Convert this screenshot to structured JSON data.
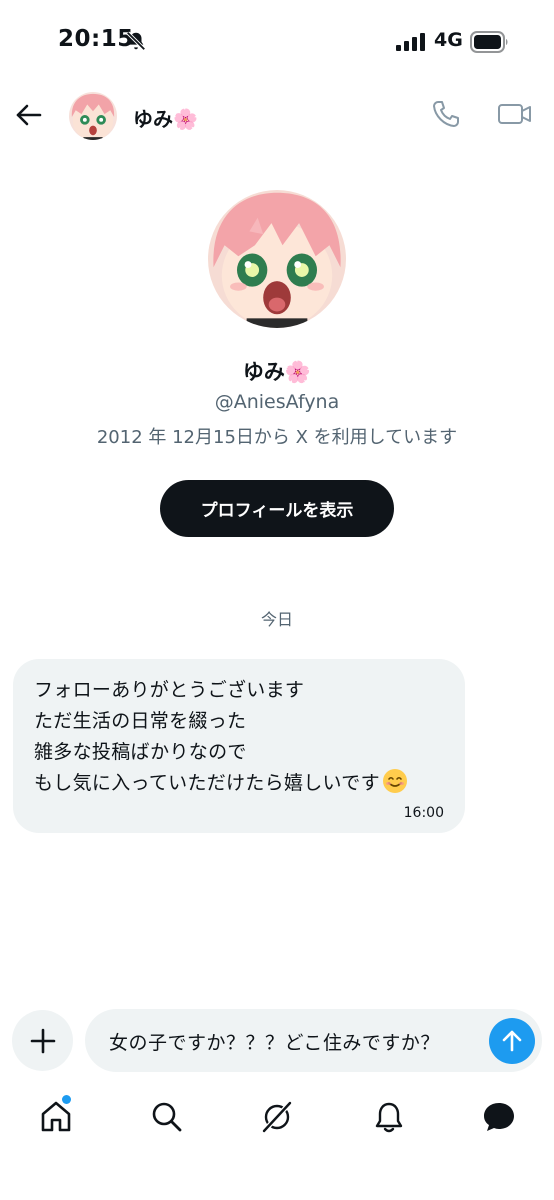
{
  "status_bar": {
    "time": "20:15",
    "network": "4G",
    "icons": [
      "bell-off-icon",
      "signal-icon",
      "battery-icon"
    ]
  },
  "header": {
    "name": "ゆみ🌸",
    "icons": [
      "back-arrow-icon",
      "phone-icon",
      "video-camera-icon"
    ]
  },
  "profile": {
    "name": "ゆみ🌸",
    "handle": "@AniesAfyna",
    "joined": "2012 年 12月15日から X を利用しています",
    "view_profile_label": "プロフィールを表示"
  },
  "conversation": {
    "date_label": "今日",
    "messages": [
      {
        "lines": [
          "フォローありがとうございます",
          "ただ生活の日常を綴った",
          "雑多な投稿ばかりなので",
          "もし気に入っていただけたら嬉しいです"
        ],
        "emoji": "smiling-face-icon",
        "time": "16:00"
      }
    ]
  },
  "composer": {
    "text": "女の子ですか？？？どこ住みですか？",
    "icons": [
      "plus-icon",
      "send-arrow-icon"
    ]
  },
  "bottom_nav": {
    "items": [
      "home-icon",
      "search-icon",
      "grok-icon",
      "notifications-icon",
      "messages-icon"
    ],
    "home_has_badge": true
  },
  "colors": {
    "accent": "#1d9bf0",
    "text": "#0f1419",
    "secondary_text": "#536471",
    "bubble": "#eff3f4",
    "button_dark": "#0f1419"
  }
}
